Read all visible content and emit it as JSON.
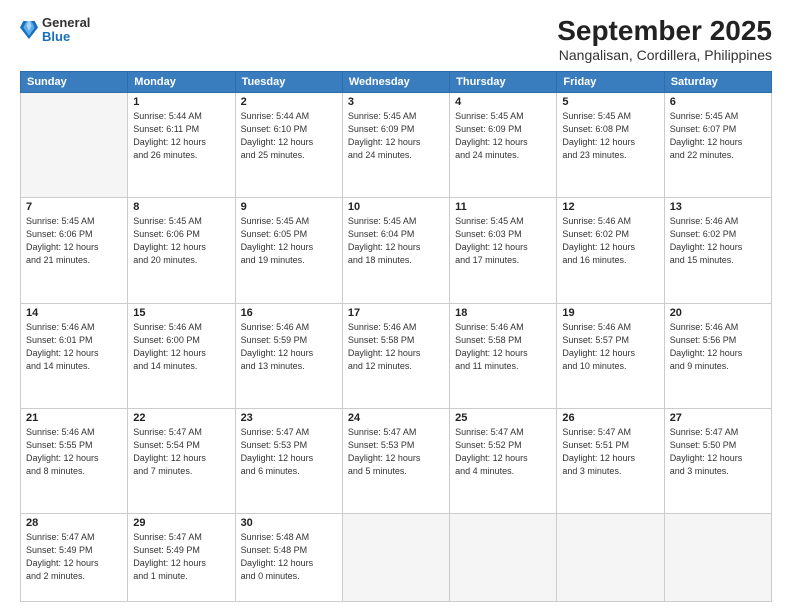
{
  "logo": {
    "general": "General",
    "blue": "Blue"
  },
  "header": {
    "title": "September 2025",
    "subtitle": "Nangalisan, Cordillera, Philippines"
  },
  "weekdays": [
    "Sunday",
    "Monday",
    "Tuesday",
    "Wednesday",
    "Thursday",
    "Friday",
    "Saturday"
  ],
  "weeks": [
    [
      {
        "day": "",
        "info": ""
      },
      {
        "day": "1",
        "info": "Sunrise: 5:44 AM\nSunset: 6:11 PM\nDaylight: 12 hours\nand 26 minutes."
      },
      {
        "day": "2",
        "info": "Sunrise: 5:44 AM\nSunset: 6:10 PM\nDaylight: 12 hours\nand 25 minutes."
      },
      {
        "day": "3",
        "info": "Sunrise: 5:45 AM\nSunset: 6:09 PM\nDaylight: 12 hours\nand 24 minutes."
      },
      {
        "day": "4",
        "info": "Sunrise: 5:45 AM\nSunset: 6:09 PM\nDaylight: 12 hours\nand 24 minutes."
      },
      {
        "day": "5",
        "info": "Sunrise: 5:45 AM\nSunset: 6:08 PM\nDaylight: 12 hours\nand 23 minutes."
      },
      {
        "day": "6",
        "info": "Sunrise: 5:45 AM\nSunset: 6:07 PM\nDaylight: 12 hours\nand 22 minutes."
      }
    ],
    [
      {
        "day": "7",
        "info": "Sunrise: 5:45 AM\nSunset: 6:06 PM\nDaylight: 12 hours\nand 21 minutes."
      },
      {
        "day": "8",
        "info": "Sunrise: 5:45 AM\nSunset: 6:06 PM\nDaylight: 12 hours\nand 20 minutes."
      },
      {
        "day": "9",
        "info": "Sunrise: 5:45 AM\nSunset: 6:05 PM\nDaylight: 12 hours\nand 19 minutes."
      },
      {
        "day": "10",
        "info": "Sunrise: 5:45 AM\nSunset: 6:04 PM\nDaylight: 12 hours\nand 18 minutes."
      },
      {
        "day": "11",
        "info": "Sunrise: 5:45 AM\nSunset: 6:03 PM\nDaylight: 12 hours\nand 17 minutes."
      },
      {
        "day": "12",
        "info": "Sunrise: 5:46 AM\nSunset: 6:02 PM\nDaylight: 12 hours\nand 16 minutes."
      },
      {
        "day": "13",
        "info": "Sunrise: 5:46 AM\nSunset: 6:02 PM\nDaylight: 12 hours\nand 15 minutes."
      }
    ],
    [
      {
        "day": "14",
        "info": "Sunrise: 5:46 AM\nSunset: 6:01 PM\nDaylight: 12 hours\nand 14 minutes."
      },
      {
        "day": "15",
        "info": "Sunrise: 5:46 AM\nSunset: 6:00 PM\nDaylight: 12 hours\nand 14 minutes."
      },
      {
        "day": "16",
        "info": "Sunrise: 5:46 AM\nSunset: 5:59 PM\nDaylight: 12 hours\nand 13 minutes."
      },
      {
        "day": "17",
        "info": "Sunrise: 5:46 AM\nSunset: 5:58 PM\nDaylight: 12 hours\nand 12 minutes."
      },
      {
        "day": "18",
        "info": "Sunrise: 5:46 AM\nSunset: 5:58 PM\nDaylight: 12 hours\nand 11 minutes."
      },
      {
        "day": "19",
        "info": "Sunrise: 5:46 AM\nSunset: 5:57 PM\nDaylight: 12 hours\nand 10 minutes."
      },
      {
        "day": "20",
        "info": "Sunrise: 5:46 AM\nSunset: 5:56 PM\nDaylight: 12 hours\nand 9 minutes."
      }
    ],
    [
      {
        "day": "21",
        "info": "Sunrise: 5:46 AM\nSunset: 5:55 PM\nDaylight: 12 hours\nand 8 minutes."
      },
      {
        "day": "22",
        "info": "Sunrise: 5:47 AM\nSunset: 5:54 PM\nDaylight: 12 hours\nand 7 minutes."
      },
      {
        "day": "23",
        "info": "Sunrise: 5:47 AM\nSunset: 5:53 PM\nDaylight: 12 hours\nand 6 minutes."
      },
      {
        "day": "24",
        "info": "Sunrise: 5:47 AM\nSunset: 5:53 PM\nDaylight: 12 hours\nand 5 minutes."
      },
      {
        "day": "25",
        "info": "Sunrise: 5:47 AM\nSunset: 5:52 PM\nDaylight: 12 hours\nand 4 minutes."
      },
      {
        "day": "26",
        "info": "Sunrise: 5:47 AM\nSunset: 5:51 PM\nDaylight: 12 hours\nand 3 minutes."
      },
      {
        "day": "27",
        "info": "Sunrise: 5:47 AM\nSunset: 5:50 PM\nDaylight: 12 hours\nand 3 minutes."
      }
    ],
    [
      {
        "day": "28",
        "info": "Sunrise: 5:47 AM\nSunset: 5:49 PM\nDaylight: 12 hours\nand 2 minutes."
      },
      {
        "day": "29",
        "info": "Sunrise: 5:47 AM\nSunset: 5:49 PM\nDaylight: 12 hours\nand 1 minute."
      },
      {
        "day": "30",
        "info": "Sunrise: 5:48 AM\nSunset: 5:48 PM\nDaylight: 12 hours\nand 0 minutes."
      },
      {
        "day": "",
        "info": ""
      },
      {
        "day": "",
        "info": ""
      },
      {
        "day": "",
        "info": ""
      },
      {
        "day": "",
        "info": ""
      }
    ]
  ]
}
